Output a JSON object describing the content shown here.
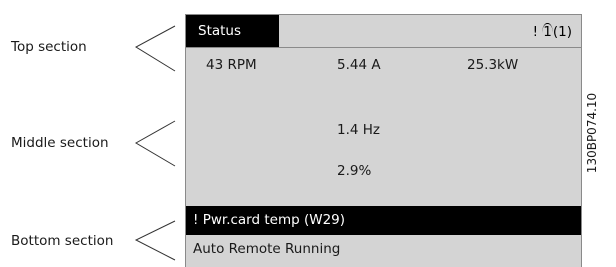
{
  "labels": {
    "top": "Top section",
    "middle": "Middle section",
    "bottom": "Bottom section"
  },
  "display": {
    "status_label": "Status",
    "menu_indicator": {
      "prefix": "! ",
      "arc_text": "1",
      "suffix": "(1)"
    },
    "readouts": {
      "speed": "43 RPM",
      "current": "5.44 A",
      "power": "25.3kW",
      "frequency": "1.4 Hz",
      "percent": "2.9%"
    },
    "warning": "! Pwr.card temp (W29)",
    "state": "Auto Remote Running"
  },
  "reference_code": "130BP074.10"
}
